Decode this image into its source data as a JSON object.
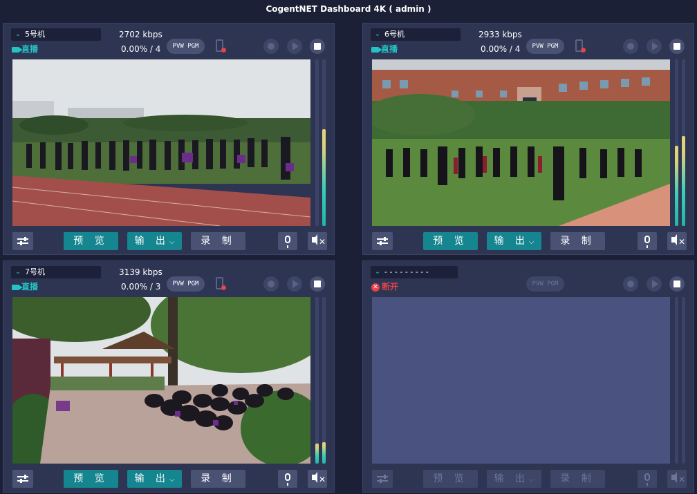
{
  "app": {
    "title": "CogentNET Dashboard 4K ( admin )"
  },
  "buttons": {
    "preview": "预 览",
    "output": "输 出",
    "output_caret": "⌵",
    "record": "录 制",
    "pvwpgm": "PVW PGM"
  },
  "colors": {
    "accent": "#23c4c4",
    "button_teal": "#15858f",
    "live": "#23c4c4",
    "disconnected": "#e8434b"
  },
  "panels": [
    {
      "camera": "5号机",
      "bitrate": "2702 kbps",
      "status": "直播",
      "loss": "0.00% / 4",
      "meter_left": 0.0,
      "meter_right": 0.58,
      "scene": "stadium"
    },
    {
      "camera": "6号机",
      "bitrate": "2933 kbps",
      "status": "直播",
      "loss": "0.00% / 4",
      "meter_left": 0.48,
      "meter_right": 0.54,
      "scene": "building"
    },
    {
      "camera": "7号机",
      "bitrate": "3139 kbps",
      "status": "直播",
      "loss": "0.00% / 3",
      "meter_left": 0.12,
      "meter_right": 0.13,
      "scene": "pavilion"
    },
    {
      "camera": "- - - - - - - - -",
      "bitrate": "",
      "status": "断开",
      "loss": "",
      "meter_left": 0.0,
      "meter_right": 0.0,
      "scene": ""
    }
  ]
}
